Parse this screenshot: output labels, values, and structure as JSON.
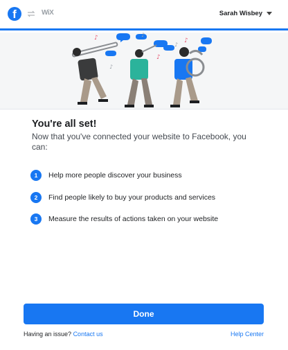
{
  "header": {
    "user_name": "Sarah Wisbey",
    "wix_logo_text": "WiX"
  },
  "main": {
    "title": "You're all set!",
    "subtitle": "Now that you've connected your website to Facebook, you can:",
    "steps": [
      {
        "num": "1",
        "text": "Help more people discover your business"
      },
      {
        "num": "2",
        "text": "Find people likely to buy your products and services"
      },
      {
        "num": "3",
        "text": "Measure the results of actions taken on your website"
      }
    ],
    "done_label": "Done"
  },
  "footer": {
    "issue_text": "Having an issue?",
    "contact_label": "Contact us",
    "help_label": "Help Center"
  },
  "colors": {
    "brand": "#1877f2",
    "hero_bg": "#f5f6f7",
    "text": "#1c1e21"
  }
}
